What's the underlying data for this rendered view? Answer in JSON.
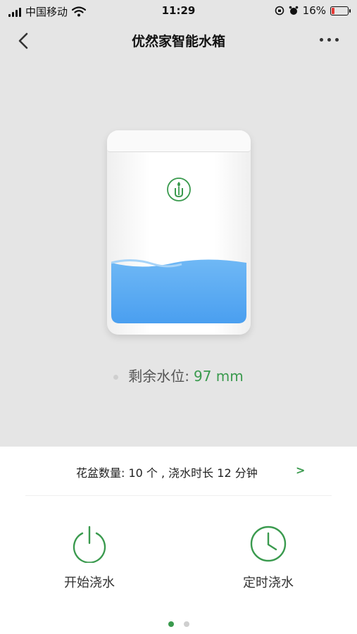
{
  "status_bar": {
    "carrier": "中国移动",
    "time": "11:29",
    "battery": "16%"
  },
  "nav": {
    "title": "优然家智能水箱"
  },
  "tank": {
    "water_level_fraction": 0.32
  },
  "level": {
    "label": "剩余水位:",
    "value": "97 mm"
  },
  "info": {
    "text": "花盆数量: 10 个 , 浇水时长 12 分钟",
    "arrow": ">"
  },
  "actions": {
    "start_label": "开始浇水",
    "timer_label": "定时浇水"
  },
  "pager": {
    "current": 1,
    "total": 2
  },
  "colors": {
    "accent": "#3a9a4e",
    "water": "#5aa9f0",
    "background": "#e5e5e5"
  }
}
